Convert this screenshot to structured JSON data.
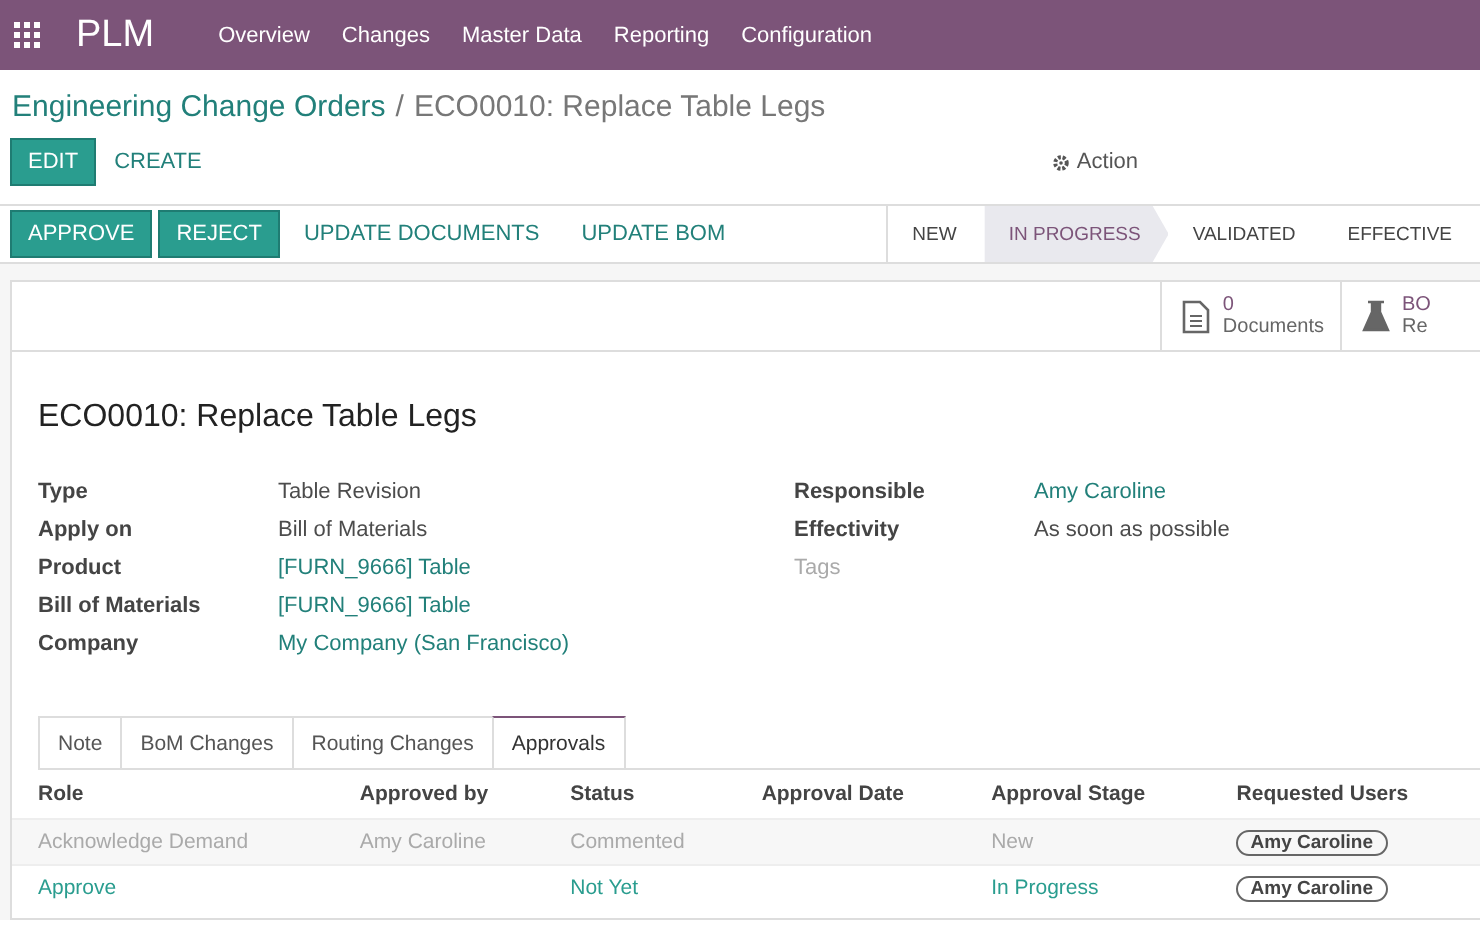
{
  "app": {
    "name": "PLM",
    "menu": [
      "Overview",
      "Changes",
      "Master Data",
      "Reporting",
      "Configuration"
    ]
  },
  "breadcrumb": {
    "parent": "Engineering Change Orders",
    "separator": "/",
    "current": "ECO0010: Replace Table Legs"
  },
  "actions": {
    "buttons": [
      {
        "label": "EDIT",
        "kind": "primary"
      },
      {
        "label": "CREATE",
        "kind": "link"
      }
    ],
    "action_menu": "Action"
  },
  "header_buttons": [
    {
      "label": "APPROVE",
      "kind": "primary"
    },
    {
      "label": "REJECT",
      "kind": "primary"
    },
    {
      "label": "UPDATE DOCUMENTS",
      "kind": "link"
    },
    {
      "label": "UPDATE BOM",
      "kind": "link"
    }
  ],
  "stages": [
    {
      "label": "NEW",
      "selected": false
    },
    {
      "label": "IN PROGRESS",
      "selected": true
    },
    {
      "label": "VALIDATED",
      "selected": false
    },
    {
      "label": "EFFECTIVE",
      "selected": false
    }
  ],
  "stat_buttons": [
    {
      "kind": "document",
      "count": "0",
      "label": "Documents"
    },
    {
      "kind": "flask",
      "count": "BO",
      "label": "Re"
    }
  ],
  "title": "ECO0010: Replace Table Legs",
  "fields_left": [
    {
      "label": "Type",
      "value": "Table Revision",
      "kind": "text"
    },
    {
      "label": "Apply on",
      "value": "Bill of Materials",
      "kind": "text"
    },
    {
      "label": "Product",
      "value": "[FURN_9666] Table",
      "kind": "link"
    },
    {
      "label": "Bill of Materials",
      "value": "[FURN_9666] Table",
      "kind": "link"
    },
    {
      "label": "Company",
      "value": "My Company (San Francisco)",
      "kind": "link"
    }
  ],
  "fields_right": [
    {
      "label": "Responsible",
      "value": "Amy Caroline",
      "kind": "link"
    },
    {
      "label": "Effectivity",
      "value": "As soon as possible",
      "kind": "text"
    }
  ],
  "tags": {
    "placeholder": "Tags"
  },
  "tabs": [
    {
      "label": "Note",
      "selected": false
    },
    {
      "label": "BoM Changes",
      "selected": false
    },
    {
      "label": "Routing Changes",
      "selected": false
    },
    {
      "label": "Approvals",
      "selected": true
    }
  ],
  "table": {
    "columns": [
      "Role",
      "Approved by",
      "Status",
      "Approval Date",
      "Approval Stage",
      "Requested Users"
    ],
    "rows": [
      {
        "cells": [
          "Acknowledge Demand",
          "Amy Caroline",
          "Commented",
          "",
          "New"
        ],
        "users": [
          "Amy Caroline"
        ],
        "muted": true
      },
      {
        "cells": [
          "Approve",
          "",
          "Not Yet",
          "",
          "In Progress"
        ],
        "users": [
          "Amy Caroline"
        ],
        "muted": false
      }
    ]
  }
}
